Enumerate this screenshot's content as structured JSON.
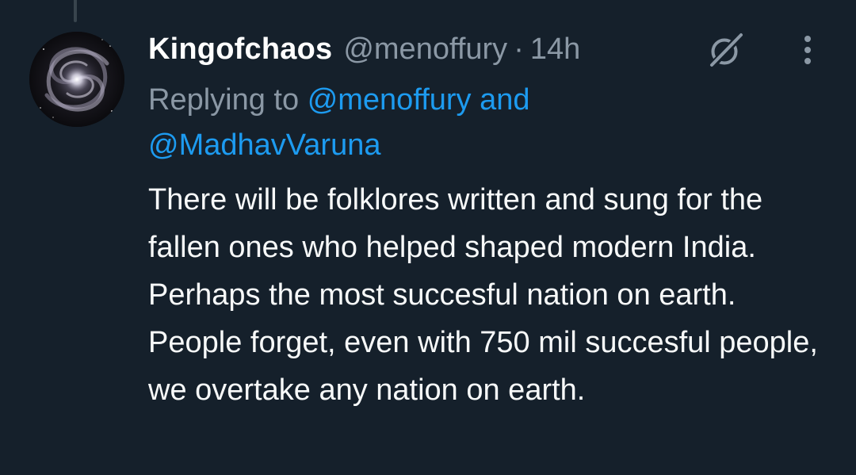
{
  "tweet": {
    "author": {
      "display_name": "Kingofchaos",
      "handle": "@menoffury",
      "avatar": "galaxy-avatar"
    },
    "separator": "·",
    "time": "14h",
    "replying_to": {
      "prefix": "Replying to",
      "mention_1": "@menoffury",
      "conjunction": "and",
      "mention_2": "@MadhavVaruna"
    },
    "text": "There will be folklores written and sung for the fallen ones who helped shaped modern India. Perhaps the most succesful nation on earth. People forget, even with 750 mil succesful people, we overtake any nation on earth."
  },
  "icons": {
    "grok": "grok-icon",
    "more": "more-options-icon"
  },
  "colors": {
    "background": "#15202b",
    "primary_text": "#f7f9f9",
    "secondary_text": "#8b98a5",
    "accent": "#1d9bf0",
    "thread_line": "#38444d"
  }
}
